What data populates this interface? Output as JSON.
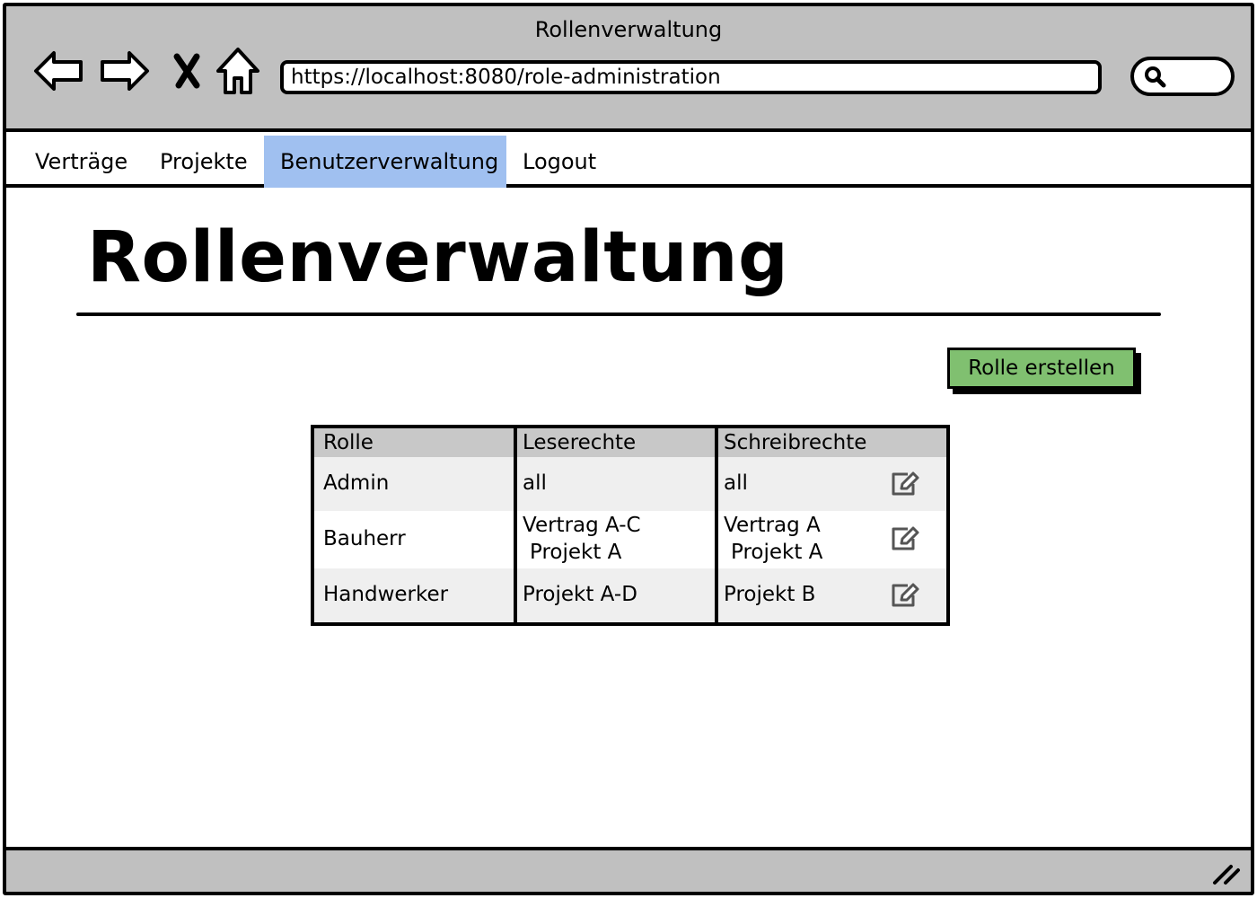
{
  "window": {
    "title": "Rollenverwaltung"
  },
  "browser": {
    "url": "https://localhost:8080/role-administration",
    "icons": [
      "back-arrow-icon",
      "forward-arrow-icon",
      "close-x-icon",
      "home-icon",
      "search-icon"
    ]
  },
  "menu": {
    "items": [
      {
        "label": "Verträge",
        "active": false
      },
      {
        "label": "Projekte",
        "active": false
      },
      {
        "label": "Benutzerverwaltung",
        "active": true
      },
      {
        "label": "Logout",
        "active": false
      }
    ]
  },
  "page": {
    "heading": "Rollenverwaltung",
    "create_button": "Rolle erstellen"
  },
  "table": {
    "columns": [
      "Rolle",
      "Leserechte",
      "Schreibrechte"
    ],
    "rows": [
      {
        "role": "Admin",
        "read": [
          "all"
        ],
        "write": [
          "all"
        ]
      },
      {
        "role": "Bauherr",
        "read": [
          "Vertrag A-C",
          "Projekt A"
        ],
        "write": [
          "Vertrag A",
          "Projekt A"
        ]
      },
      {
        "role": "Handwerker",
        "read": [
          "Projekt A-D"
        ],
        "write": [
          "Projekt B"
        ]
      }
    ],
    "row_action_icon": "edit-icon"
  },
  "colors": {
    "chrome_gray": "#c0c0c0",
    "active_tab": "#a0c0f0",
    "create_button": "#80c070",
    "header_row": "#c8c8c8",
    "stripe_row": "#efefef",
    "icon_gray": "#555555"
  }
}
